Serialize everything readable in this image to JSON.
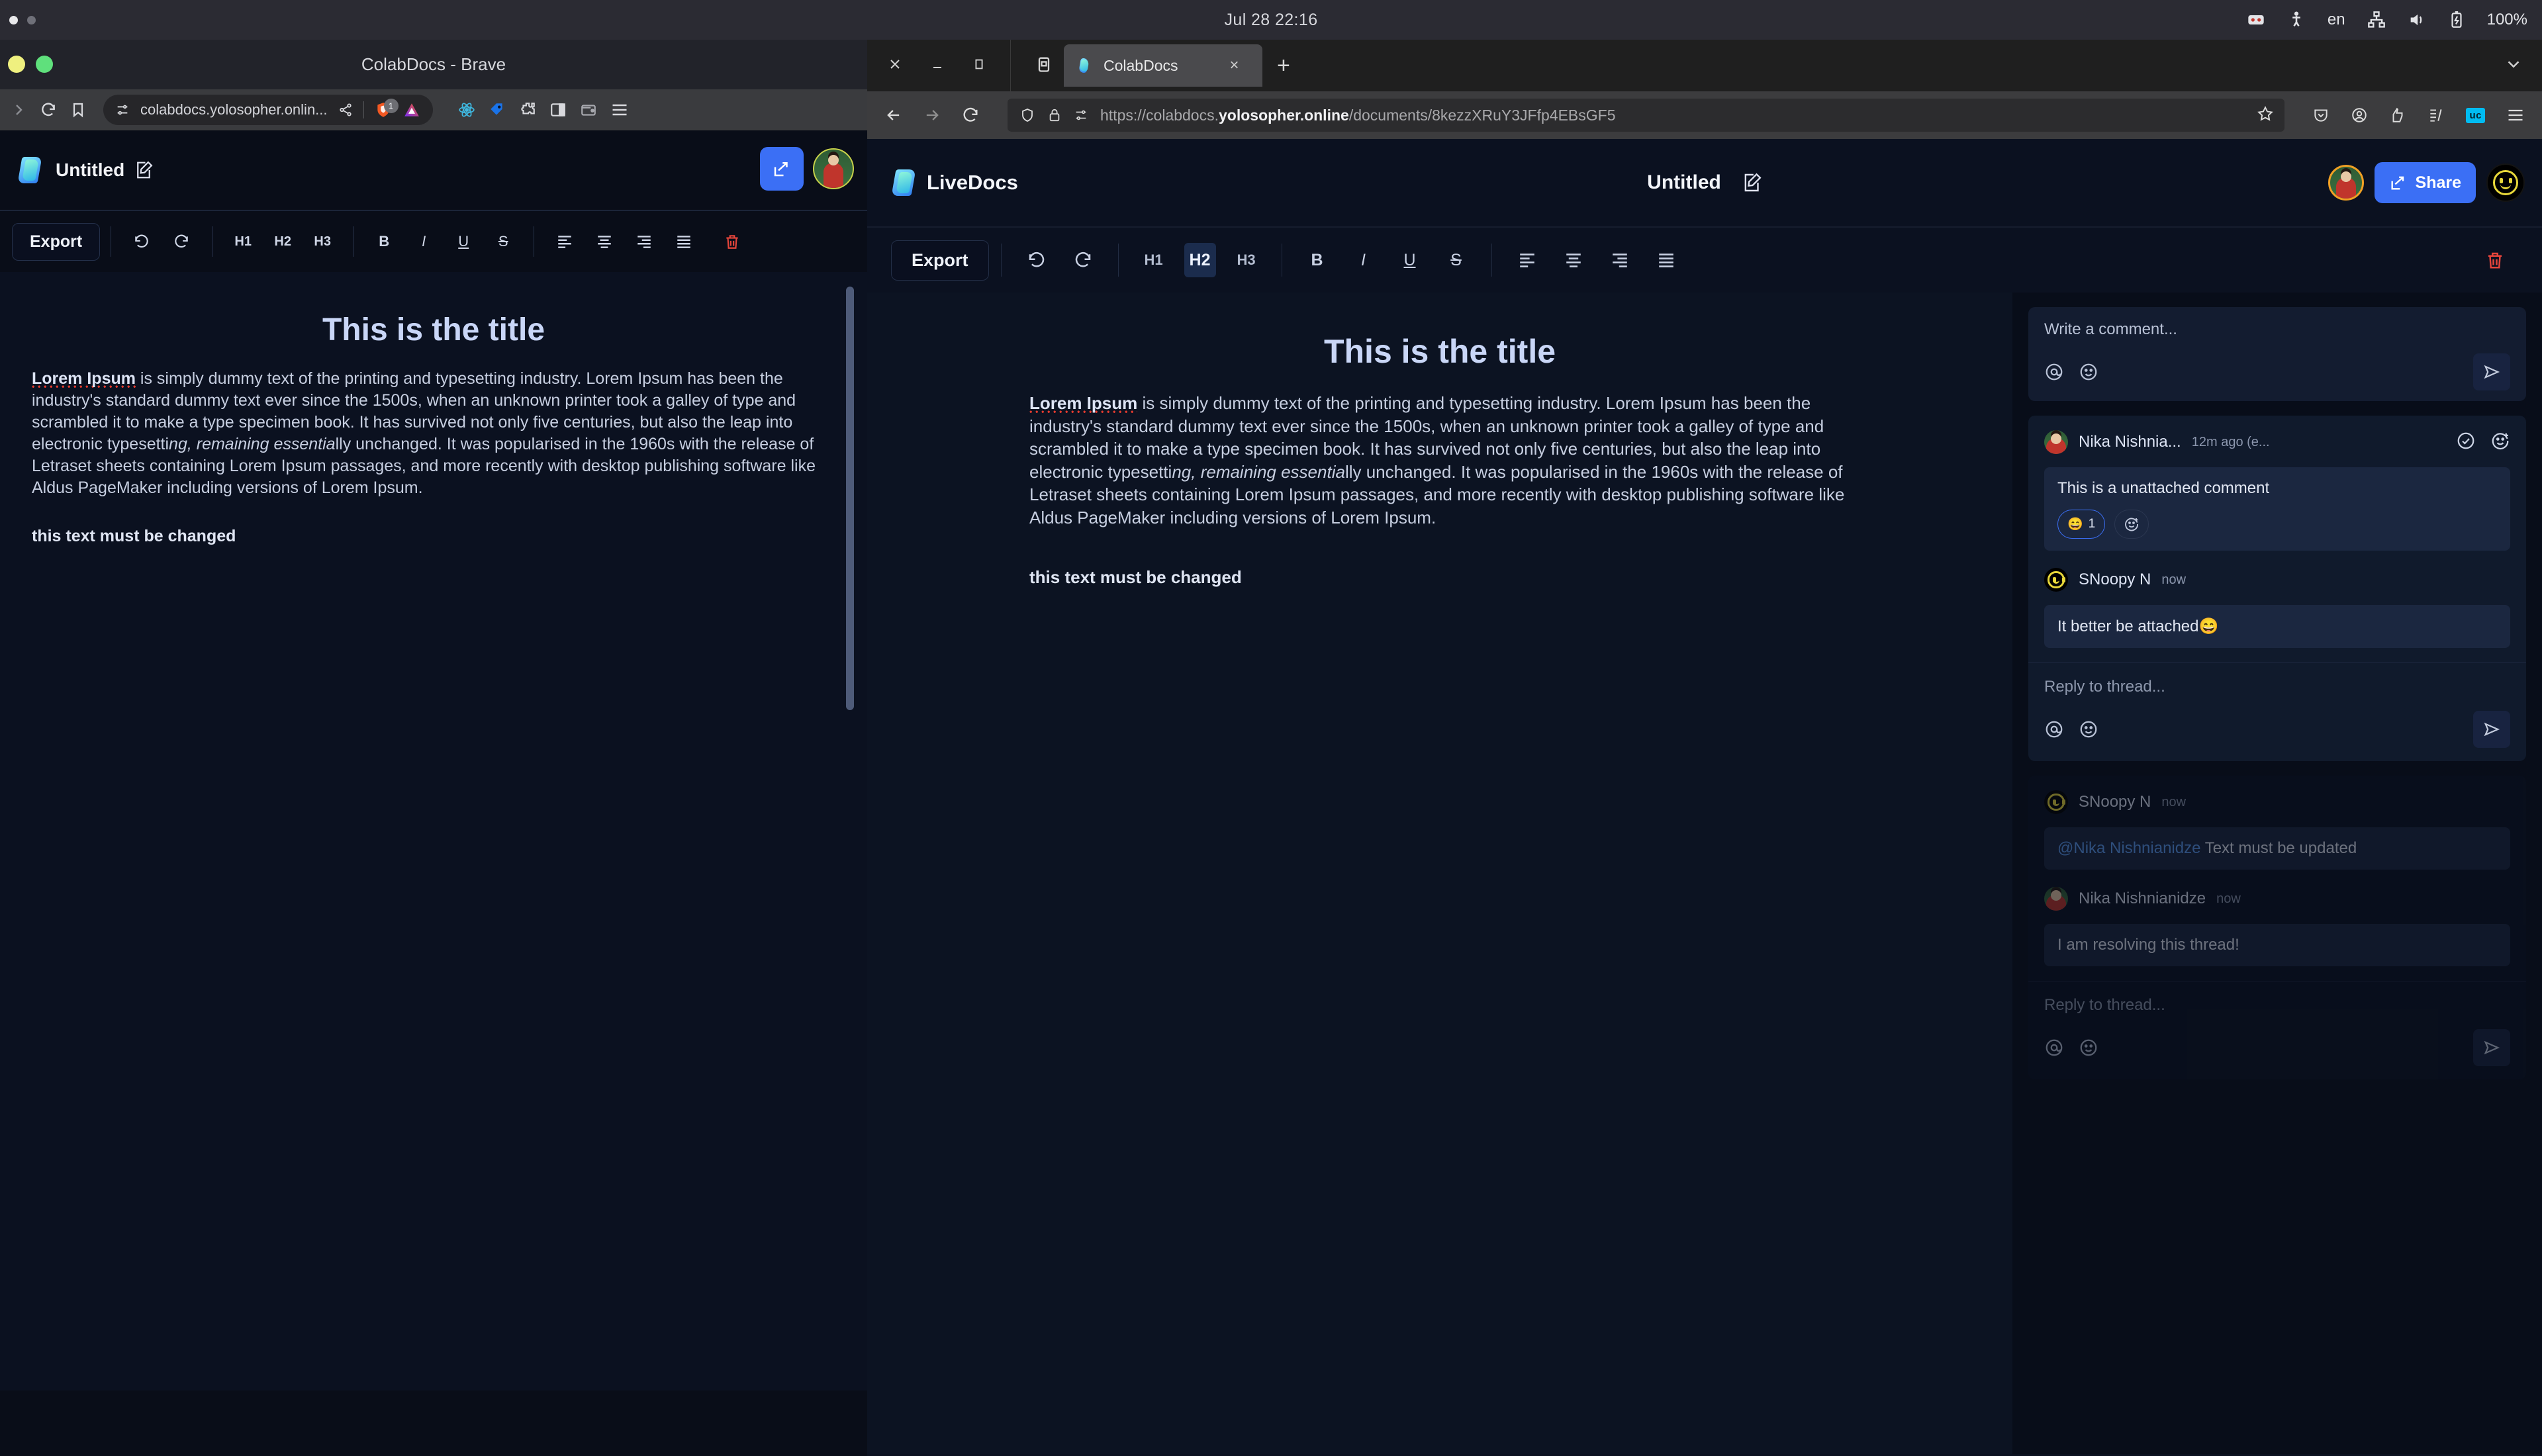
{
  "os_bar": {
    "clock": "Jul 28  22:16",
    "lang": "en",
    "battery": "100%",
    "tray_icons": [
      "media-icon",
      "accessibility-icon",
      "network-icon",
      "volume-icon",
      "battery-icon"
    ]
  },
  "brave_window": {
    "title": "ColabDocs - Brave",
    "url": "colabdocs.yolosopher.onlin...",
    "toolbar_icons": [
      "forward-icon",
      "reload-icon",
      "bookmark-icon",
      "site-settings-icon",
      "share-icon",
      "brave-shields-icon",
      "brave-rewards-icon",
      "react-devtools-icon",
      "extension-tag-icon",
      "extensions-puzzle-icon",
      "sidebar-icon",
      "wallet-icon",
      "menu-icon"
    ],
    "shield_badge": "1"
  },
  "left_app": {
    "doc_title": "Untitled",
    "toolbar": {
      "export_label": "Export",
      "undo": "undo-icon",
      "redo": "redo-icon",
      "h1": "H1",
      "h2": "H2",
      "h3": "H3",
      "bold": "B",
      "italic": "I",
      "underline": "U",
      "strike": "S",
      "align_left": "align-left-icon",
      "align_center": "align-center-icon",
      "align_right": "align-right-icon",
      "align_justify": "align-justify-icon",
      "delete": "trash-icon"
    },
    "document": {
      "title": "This is the title",
      "paragraph_lead": "Lorem Ipsum",
      "paragraph_rest": " is simply dummy text of the printing and typesetting industry. Lorem Ipsum has been the industry's standard dummy text ever since the 1500s, when an unknown printer took a galley of type and scrambled it to make a type specimen book. It has survived not only five centuries, but also the leap into electronic typesetti",
      "paragraph_italic": "ng, remaining essentia",
      "paragraph_tail": "lly unchanged. It was popularised in the 1960s with the release of Letraset sheets containing Lorem Ipsum passages, and more recently with desktop publishing software like Aldus PageMaker including versions of Lorem Ipsum.",
      "note": "this text must be changed"
    }
  },
  "firefox_window": {
    "tab_title": "ColabDocs",
    "new_tab_label": "+",
    "close_tab_label": "×",
    "window_controls": [
      "close-icon",
      "minimize-icon",
      "maximize-icon",
      "firefox-view-icon"
    ],
    "url": "https://colabdocs.yolosopher.online/documents/8kezzXRuY3JFfp4EBsGF5",
    "url_host_bold": "yolosopher.online",
    "url_prefix": "https://colabdocs.",
    "url_path": "/documents/8kezzXRuY3JFfp4EBsGF5",
    "toolbar_icons": [
      "back-icon",
      "forward-icon",
      "reload-icon",
      "shield-icon",
      "lock-icon",
      "site-settings-icon",
      "bookmark-star-icon",
      "pocket-icon",
      "account-icon",
      "extension-icon",
      "reader-icon",
      "uc-extension-icon",
      "hamburger-menu-icon"
    ],
    "uc_chip": "uc"
  },
  "livedocs": {
    "brand": "LiveDocs",
    "doc_title": "Untitled",
    "share_label": "Share",
    "toolbar": {
      "export_label": "Export",
      "undo": "undo-icon",
      "redo": "redo-icon",
      "h1": "H1",
      "h2": "H2",
      "h3": "H3",
      "active_heading": "H2",
      "bold": "B",
      "italic": "I",
      "underline": "U",
      "strike": "S",
      "align_left": "align-left-icon",
      "align_center": "align-center-icon",
      "align_right": "align-right-icon",
      "align_justify": "align-justify-icon",
      "delete": "trash-icon"
    },
    "document": {
      "title": "This is the title",
      "paragraph_lead": "Lorem Ipsum",
      "paragraph_rest": " is simply dummy text of the printing and typesetting industry. Lorem Ipsum has been the industry's standard dummy text ever since the 1500s, when an unknown printer took a galley of type and scrambled it to make a type specimen book. It has survived not only five centuries, but also the leap into electronic typesetti",
      "paragraph_italic": "ng, remaining essentia",
      "paragraph_tail": "lly unchanged. It was popularised in the 1960s with the release of Letraset sheets containing Lorem Ipsum passages, and more recently with desktop publishing software like Aldus PageMaker including versions of Lorem Ipsum.",
      "note": "this text must be changed"
    },
    "comments": {
      "composer_placeholder": "Write a comment...",
      "reply_placeholder": "Reply to thread...",
      "threads": [
        {
          "author": "Nika Nishnia...",
          "time": "12m ago (e...",
          "body": "This is a unattached comment",
          "reaction_emoji": "😄",
          "reaction_count": "1",
          "reply_author": "SNoopy N",
          "reply_time": "now",
          "reply_body": "It better be attached😄",
          "reply_placeholder": "Reply to thread..."
        },
        {
          "author": "SNoopy N",
          "time": "now",
          "mention": "@Nika Nishnianidze",
          "body": " Text must be updated",
          "reply_author": "Nika Nishnianidze",
          "reply_time": "now",
          "reply_body": "I am resolving this thread!",
          "reply_placeholder": "Reply to thread..."
        }
      ]
    }
  },
  "colors": {
    "accent_blue": "#3b6ff5",
    "danger_red": "#e5453b",
    "doc_bg": "#0b1120",
    "panel_bg": "#080d19",
    "thread_bg": "#101a2c",
    "spellcheck_red": "#e33a2e"
  }
}
